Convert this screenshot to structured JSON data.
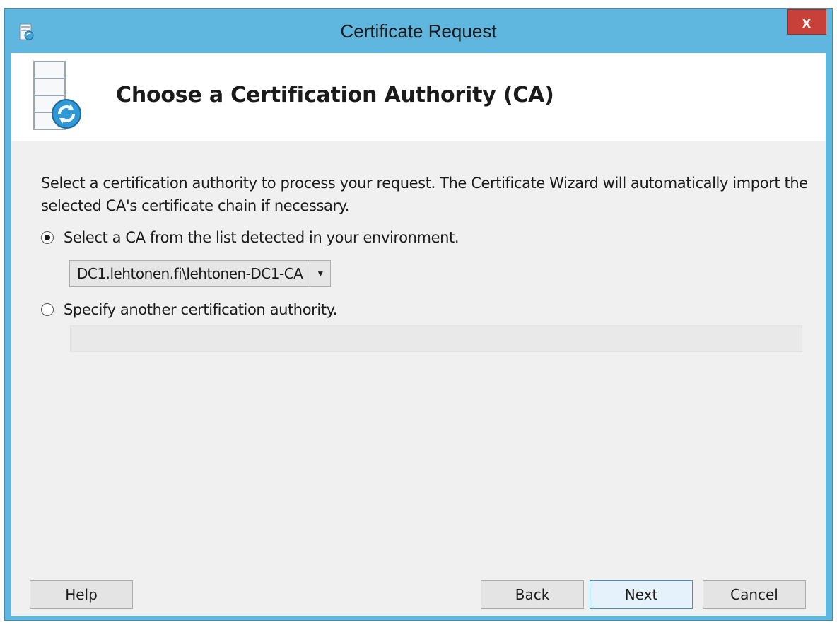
{
  "window": {
    "title": "Certificate Request",
    "close_glyph": "x",
    "app_icon": "certificate-request-icon"
  },
  "header": {
    "title": "Choose a Certification Authority (CA)",
    "icon": "certificate-wizard-icon"
  },
  "body": {
    "description": "Select a certification authority to process your request. The Certificate Wizard will automatically import the selected CA's certificate chain if necessary.",
    "option_detected": {
      "label": "Select a CA from the list detected in your environment.",
      "checked": true
    },
    "ca_dropdown": {
      "value": "DC1.lehtonen.fi\\lehtonen-DC1-CA"
    },
    "option_other": {
      "label": "Specify another certification authority.",
      "checked": false
    },
    "other_ca_value": ""
  },
  "buttons": {
    "help": "Help",
    "back": "Back",
    "next": "Next",
    "cancel": "Cancel"
  },
  "colors": {
    "titlebar": "#5fb7e0",
    "close_button": "#c7403a",
    "client_background": "#f0f0f0"
  }
}
